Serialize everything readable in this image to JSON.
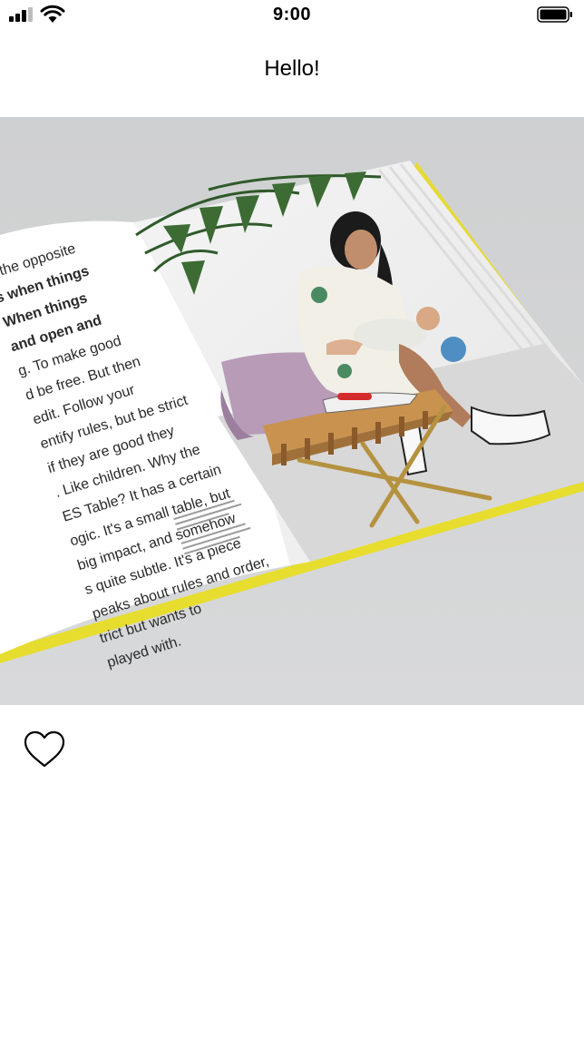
{
  "status_bar": {
    "time": "9:00",
    "signal_icon": "cellular-signal-icon",
    "wifi_icon": "wifi-icon",
    "battery_icon": "battery-icon"
  },
  "nav": {
    "title": "Hello!"
  },
  "photo": {
    "description_icon": "magazine-photo",
    "article_lines": [
      "s the opposite",
      "s when things",
      "When things",
      "and open and",
      "g. To make good",
      "d be free. But then",
      "edit. Follow your",
      "entify rules, but be strict",
      "if they are good they",
      ". Like children. Why the",
      "ES Table? It has a certain",
      "ogic. It's a small table, but",
      "big impact, and somehow",
      "s quite subtle. It's a piece",
      "peaks about rules and order,",
      "trict but wants to",
      "played with."
    ]
  },
  "actions": {
    "like_icon": "heart-outline-icon"
  }
}
